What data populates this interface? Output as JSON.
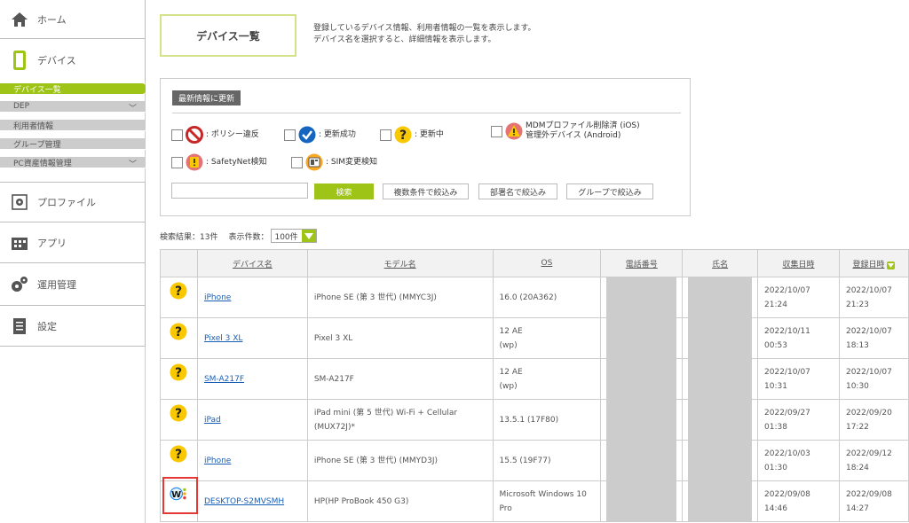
{
  "sidebar": {
    "home": "ホーム",
    "device": "デバイス",
    "sub_items": [
      "デバイス一覧",
      "DEP",
      "利用者情報",
      "グループ管理",
      "PC資産情報管理"
    ],
    "profile": "プロファイル",
    "apps": "アプリ",
    "ops": "運用管理",
    "settings": "設定"
  },
  "header": {
    "title": "デバイス一覧",
    "desc1": "登録しているデバイス情報、利用者情報の一覧を表示します。",
    "desc2": "デバイス名を選択すると、詳細情報を表示します。"
  },
  "filter": {
    "refresh_label": "最新情報に更新",
    "policy_violation": ": ポリシー違反",
    "update_success": ": 更新成功",
    "updating": ": 更新中",
    "mdm_removed_1": "MDMプロファイル削除済 (iOS)",
    "mdm_removed_2": "管理外デバイス (Android)",
    "safetynet": ": SafetyNet検知",
    "sim_change": ": SIM変更検知",
    "search_value": "",
    "search_btn": "検索",
    "multi_filter": "複数条件で絞込み",
    "dept_filter": "部署名で絞込み",
    "group_filter": "グループで絞込み"
  },
  "results": {
    "count_label": "検索結果：13件",
    "per_page_label": "表示件数：",
    "per_page_value": "100件"
  },
  "table": {
    "headers": [
      "デバイス名",
      "モデル名",
      "OS",
      "電話番号",
      "氏名",
      "収集日時",
      "登録日時"
    ],
    "rows": [
      {
        "status": "updating",
        "device": "iPhone",
        "model": "iPhone SE (第 3 世代) (MMYC3J)",
        "os": "16.0 (20A362)",
        "collected": "2022/10/07\n21:24",
        "registered": "2022/10/07\n21:23"
      },
      {
        "status": "updating",
        "device": "Pixel 3 XL",
        "model": "Pixel 3 XL",
        "os": "12 AE\n(wp)",
        "collected": "2022/10/11\n00:53",
        "registered": "2022/10/07\n18:13"
      },
      {
        "status": "updating",
        "device": "SM-A217F",
        "model": "SM-A217F",
        "os": "12 AE\n(wp)",
        "collected": "2022/10/07\n10:31",
        "registered": "2022/10/07\n10:30"
      },
      {
        "status": "updating",
        "device": "iPad",
        "model": "iPad mini (第 5 世代) Wi-Fi + Cellular (MUX72J)*",
        "os": "13.5.1 (17F80)",
        "collected": "2022/09/27\n01:38",
        "registered": "2022/09/20\n17:22"
      },
      {
        "status": "updating",
        "device": "iPhone",
        "model": "iPhone SE (第 3 世代) (MMYD3J)",
        "os": "15.5 (19F77)",
        "collected": "2022/10/03\n01:30",
        "registered": "2022/09/12\n18:24"
      },
      {
        "status": "windows-agent",
        "device": "DESKTOP-S2MVSMH",
        "model": "HP(HP ProBook 450 G3)",
        "os": "Microsoft Windows 10\nPro",
        "collected": "2022/09/08\n14:46",
        "registered": "2022/09/08\n14:27"
      }
    ]
  },
  "colors": {
    "accent": "#9ec417",
    "highlight": "#e53935",
    "link": "#1a5fb4"
  }
}
